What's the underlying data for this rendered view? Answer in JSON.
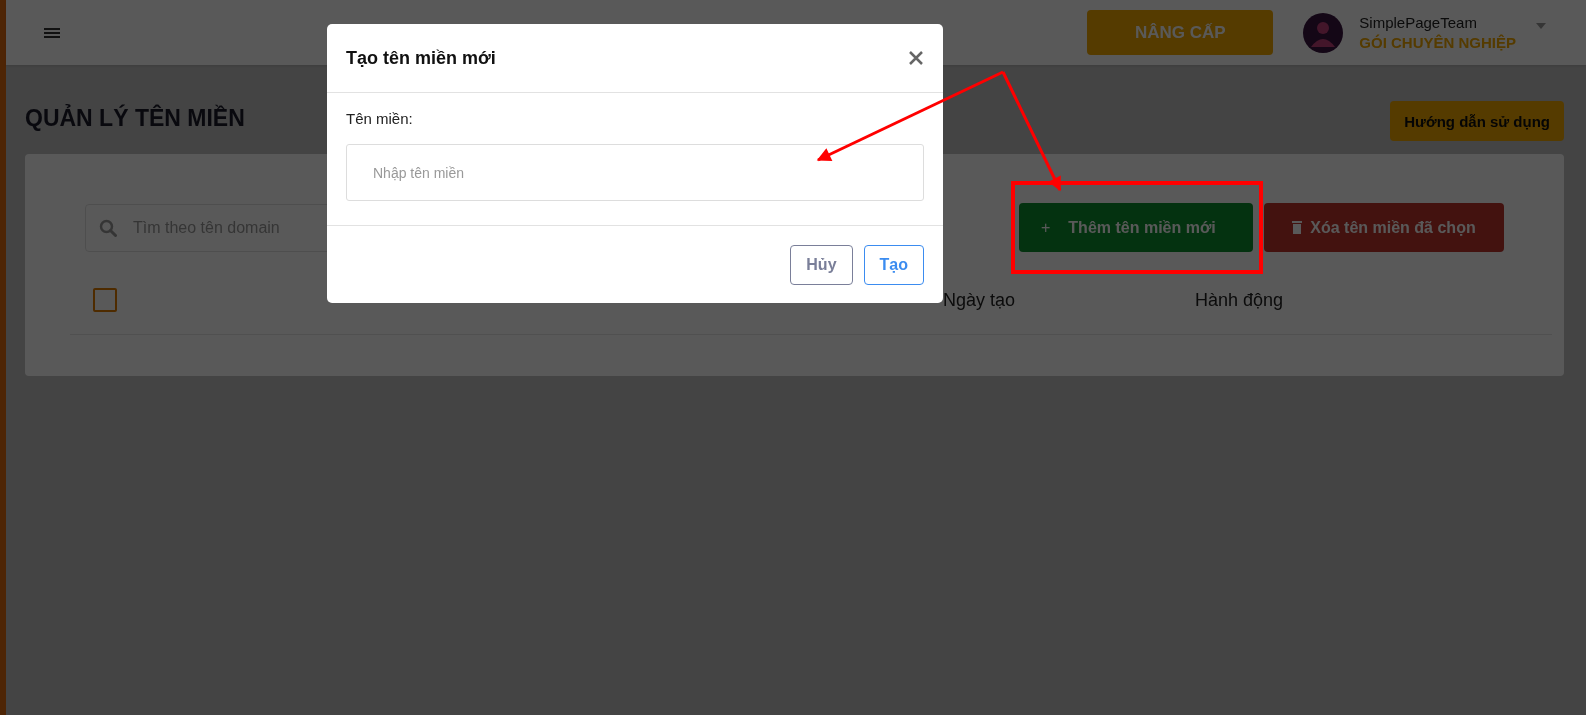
{
  "header": {
    "upgrade_button": "NÂNG CẤP",
    "user": {
      "name": "SimplePageTeam",
      "plan": "GÓI CHUYÊN NGHIỆP"
    }
  },
  "page": {
    "title": "QUẢN LÝ TÊN MIỀN",
    "guide_button": "Hướng dẫn sử dụng"
  },
  "toolbar": {
    "search": {
      "placeholder": "Tìm theo tên domain"
    },
    "add_button": {
      "icon": "+",
      "label": "Thêm tên miền mới"
    },
    "delete_button": {
      "label": "Xóa tên miền đã chọn"
    }
  },
  "table": {
    "select_all": {
      "checked": false
    },
    "columns": [
      {
        "label": "Ngày tạo"
      },
      {
        "label": "Hành động"
      }
    ]
  },
  "dialog": {
    "title": "Tạo tên miền mới",
    "field": {
      "label": "Tên miền:",
      "placeholder": "Nhập tên miền"
    },
    "buttons": [
      {
        "label": "Hủy",
        "kind": "secondary"
      },
      {
        "label": "Tạo",
        "kind": "primary"
      }
    ]
  }
}
